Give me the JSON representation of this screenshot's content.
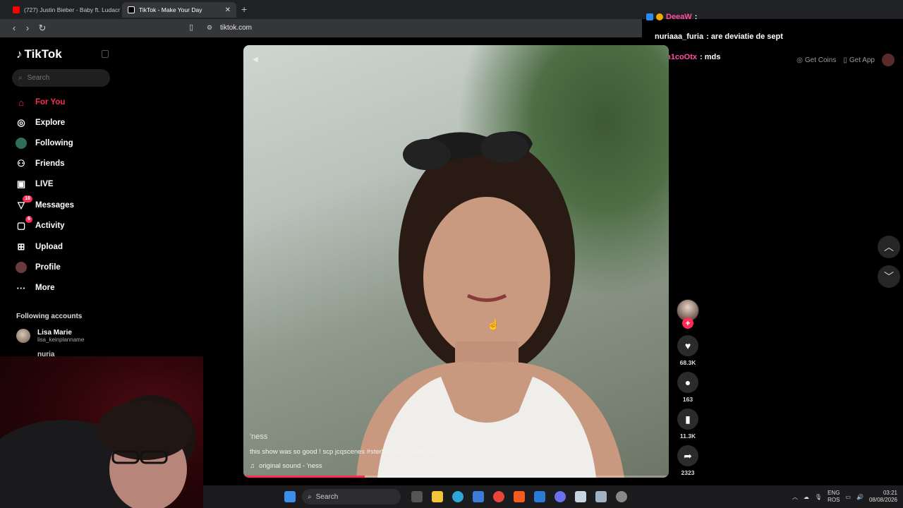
{
  "browser": {
    "tabs": [
      {
        "title": "(727) Justin Bieber - Baby ft. Ludacris",
        "active": false,
        "favicon_color": "#ff0000"
      },
      {
        "title": "TikTok - Make Your Day",
        "active": true,
        "favicon_color": "#ffffff"
      }
    ],
    "url": "tiktok.com"
  },
  "chat": {
    "messages": [
      {
        "user": "DeeaW",
        "text": "",
        "user_color": "#ff4fa3"
      },
      {
        "user": "nuriaaa_furia",
        "text": ": are deviatie de sept",
        "user_color": "#ffffff"
      },
      {
        "user": "n1coOtx",
        "text": ": mds",
        "user_color": "#ff4fa3"
      }
    ]
  },
  "header": {
    "get_coins": "Get Coins",
    "get_app": "Get App"
  },
  "sidebar": {
    "logo": "TikTok",
    "search_placeholder": "Search",
    "items": [
      {
        "label": "For You",
        "icon": "home-icon",
        "badge": ""
      },
      {
        "label": "Explore",
        "icon": "compass-icon",
        "badge": ""
      },
      {
        "label": "Following",
        "icon": "following-avatar-icon",
        "badge": ""
      },
      {
        "label": "Friends",
        "icon": "friends-icon",
        "badge": ""
      },
      {
        "label": "LIVE",
        "icon": "live-icon",
        "badge": ""
      },
      {
        "label": "Messages",
        "icon": "messages-icon",
        "badge": "16"
      },
      {
        "label": "Activity",
        "icon": "activity-icon",
        "badge": "6"
      },
      {
        "label": "Upload",
        "icon": "upload-icon",
        "badge": ""
      },
      {
        "label": "Profile",
        "icon": "profile-avatar-icon",
        "badge": ""
      },
      {
        "label": "More",
        "icon": "more-icon",
        "badge": ""
      }
    ],
    "following_header": "Following accounts",
    "accounts": [
      {
        "name": "Lisa Marie",
        "handle": "lisa_keinplanname"
      },
      {
        "name": "nuria",
        "handle": ""
      }
    ]
  },
  "video": {
    "author": "'ness",
    "caption": "this show was so good ! scp jcqscenes #sterlingpoint #edit #oona",
    "sound": "original sound - 'ness",
    "progress": 0.285
  },
  "actions": {
    "likes": "68.3K",
    "comments": "163",
    "saves": "11.3K",
    "shares": "2323"
  },
  "taskbar": {
    "search": "Search",
    "lang_top": "ENG",
    "lang_bottom": "ROS",
    "time": "03:21",
    "date": "08/08/2026"
  },
  "colors": {
    "accent": "#fe2c55",
    "background": "#000000"
  }
}
